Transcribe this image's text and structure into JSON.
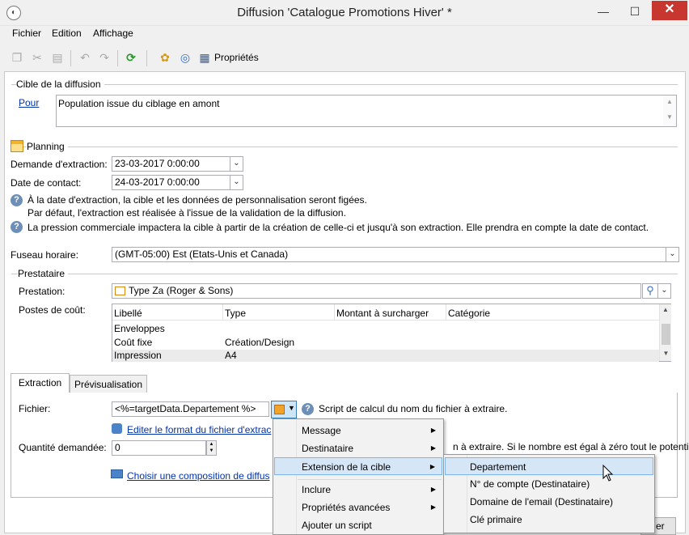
{
  "window": {
    "title": "Diffusion 'Catalogue Promotions Hiver' *",
    "minimize": "—",
    "maximize": "☐",
    "close": "✕"
  },
  "menubar": [
    "Fichier",
    "Edition",
    "Affichage"
  ],
  "toolbar": {
    "properties_label": "Propriétés"
  },
  "cible": {
    "section": "Cible de la diffusion",
    "pour_link": "Pour",
    "text": "Population issue du ciblage en amont"
  },
  "planning": {
    "section": "Planning",
    "extraction_label": "Demande d'extraction:",
    "extraction_value": "23-03-2017 0:00:00",
    "contact_label": "Date de contact:",
    "contact_value": "24-03-2017 0:00:00",
    "info1_line1": "À la date d'extraction, la cible et les données de personnalisation seront figées.",
    "info1_line2": "Par défaut, l'extraction est réalisée à l'issue de la validation de la diffusion.",
    "info2": "La pression commerciale impactera la cible à partir de la création de celle-ci et jusqu'à son extraction. Elle prendra en compte la date de contact."
  },
  "timezone": {
    "label": "Fuseau horaire:",
    "value": "(GMT-05:00) Est (Etats-Unis et Canada)"
  },
  "prestataire": {
    "section": "Prestataire",
    "prestation_label": "Prestation:",
    "prestation_value": "Type Za (Roger & Sons)",
    "postes_label": "Postes de coût:",
    "columns": [
      "Libellé",
      "Type",
      "Montant à surcharger",
      "Catégorie"
    ],
    "rows": [
      [
        "Enveloppes",
        "",
        "",
        ""
      ],
      [
        "Coût fixe",
        "Création/Design",
        "",
        ""
      ],
      [
        "Impression",
        "A4",
        "",
        ""
      ]
    ]
  },
  "tabs": [
    "Extraction",
    "Prévisualisation"
  ],
  "extraction": {
    "fichier_label": "Fichier:",
    "fichier_value": "<%=targetData.Departement %>",
    "fichier_hint": "Script de calcul du nom du fichier à extraire.",
    "edit_format_link": "Editer le format du fichier d'extrac",
    "quantite_label": "Quantité demandée:",
    "quantite_value": "0",
    "quantite_hint": "n à extraire. Si le nombre est égal à zéro tout le potentie",
    "composition_link": "Choisir une composition de diffus",
    "bottom_button": "er"
  },
  "context_menu": {
    "items": [
      "Message",
      "Destinataire",
      "Extension de la cible",
      "Inclure",
      "Propriétés avancées",
      "Ajouter un script"
    ]
  },
  "submenu": {
    "items": [
      "Departement",
      "N° de compte (Destinataire)",
      "Domaine de l'email (Destinataire)",
      "Clé primaire"
    ]
  }
}
